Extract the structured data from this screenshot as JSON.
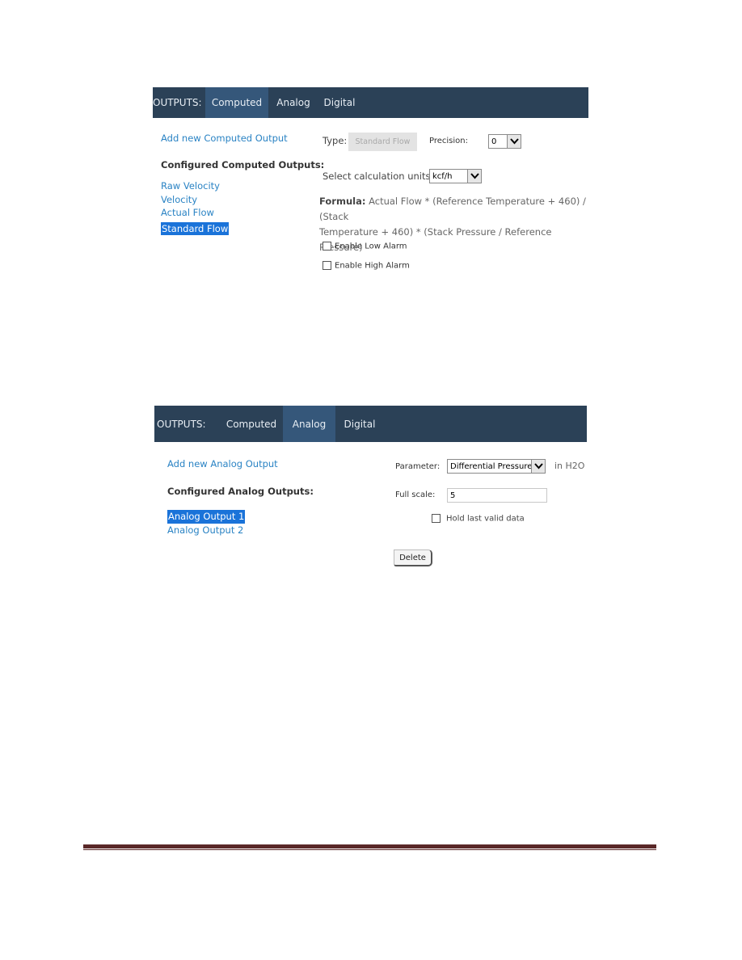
{
  "computed_panel": {
    "nav": {
      "label": "OUTPUTS:",
      "tabs": [
        {
          "label": "Computed",
          "active": true
        },
        {
          "label": "Analog",
          "active": false
        },
        {
          "label": "Digital",
          "active": false
        }
      ]
    },
    "add_link": "Add new Computed Output",
    "configured_heading": "Configured Computed Outputs:",
    "outputs": [
      "Raw Velocity",
      "Velocity",
      "Actual Flow",
      "Standard Flow"
    ],
    "selected_output": "Standard Flow",
    "type_label": "Type:",
    "type_value": "Standard Flow",
    "precision_label": "Precision:",
    "precision_value": "0",
    "units_label": "Select calculation units:",
    "units_value": "kcf/h",
    "formula_label": "Formula:",
    "formula_line1": "Actual Flow * (Reference Temperature + 460) / (Stack",
    "formula_line2": "Temperature + 460) * (Stack Pressure / Reference Pressure)",
    "low_alarm_label": "Enable Low Alarm",
    "low_alarm_checked": false,
    "high_alarm_label": "Enable High Alarm",
    "high_alarm_checked": false
  },
  "analog_panel": {
    "nav": {
      "label": "OUTPUTS:",
      "tabs": [
        {
          "label": "Computed",
          "active": false
        },
        {
          "label": "Analog",
          "active": true
        },
        {
          "label": "Digital",
          "active": false
        }
      ]
    },
    "add_link": "Add new Analog Output",
    "configured_heading": "Configured Analog Outputs:",
    "outputs": [
      "Analog Output 1",
      "Analog Output 2"
    ],
    "selected_output": "Analog Output 1",
    "parameter_label": "Parameter:",
    "parameter_value": "Differential Pressure",
    "parameter_unit": "in H2O",
    "full_scale_label": "Full scale:",
    "full_scale_value": "5",
    "hold_label": "Hold last valid data",
    "hold_checked": false,
    "delete_label": "Delete"
  },
  "colors": {
    "nav_bg": "#2b4157",
    "nav_active": "#35577a",
    "link": "#2a83c4",
    "selection": "#1a73d9",
    "footer_rule": "#5a2828"
  }
}
